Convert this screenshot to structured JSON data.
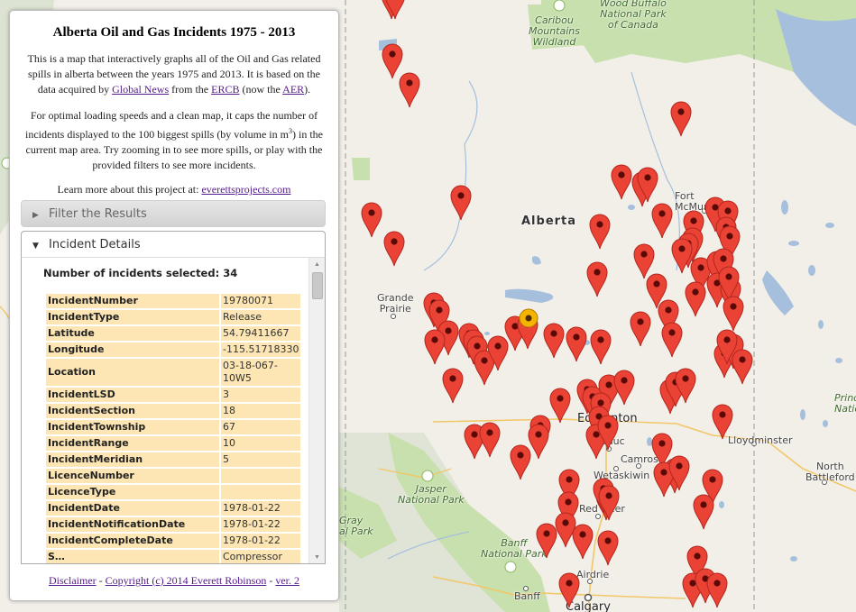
{
  "panel": {
    "title": "Alberta Oil and Gas Incidents 1975 - 2013",
    "intro": {
      "text1": "This is a map that interactively graphs all of the Oil and Gas related spills in alberta between the years 1975 and 2013. It is based on the data acquired by ",
      "link_global_news": "Global News",
      "text2": " from the ",
      "link_ercb": "ERCB",
      "text3": " (now the ",
      "link_aer": "AER",
      "text4": ")."
    },
    "cap_note": {
      "text1": "For optimal loading speeds and a clean map, it caps the number of incidents displayed to the 100 biggest spills (by volume in m",
      "sup": "3",
      "text2": ") in the current map area. Try zooming in to see more spills, or play with the provided filters to see more incidents."
    },
    "learn_more": {
      "text": "Learn more about this project at: ",
      "link": "everettsprojects.com"
    },
    "filter_section": {
      "label": "Filter the Results",
      "expanded": false
    },
    "details_section": {
      "label": "Incident Details",
      "expanded": true,
      "count_label": "Number of incidents selected: 34",
      "rows": [
        {
          "key": "IncidentNumber",
          "value": "19780071"
        },
        {
          "key": "IncidentType",
          "value": "Release"
        },
        {
          "key": "Latitude",
          "value": "54.79411667"
        },
        {
          "key": "Longitude",
          "value": "-115.51718330"
        },
        {
          "key": "Location",
          "value": "03-18-067-10W5"
        },
        {
          "key": "IncidentLSD",
          "value": "3"
        },
        {
          "key": "IncidentSection",
          "value": "18"
        },
        {
          "key": "IncidentTownship",
          "value": "67"
        },
        {
          "key": "IncidentRange",
          "value": "10"
        },
        {
          "key": "IncidentMeridian",
          "value": "5"
        },
        {
          "key": "LicenceNumber",
          "value": ""
        },
        {
          "key": "LicenceType",
          "value": ""
        },
        {
          "key": "IncidentDate",
          "value": "1978-01-22"
        },
        {
          "key": "IncidentNotificationDate",
          "value": "1978-01-22"
        },
        {
          "key": "IncidentCompleteDate",
          "value": "1978-01-22"
        },
        {
          "key": "S…",
          "value": "Compressor"
        }
      ]
    },
    "footer": {
      "disclaimer": "Disclaimer",
      "sep1": " - ",
      "copyright": "Copyright (c) 2014 Everett Robinson",
      "sep2": " - ",
      "version": "ver. 2"
    }
  },
  "map": {
    "labels": {
      "caribou": "Caribou\nMountains\nWildland",
      "wood_buffalo": "Wood Buffalo\nNational Park\nof Canada",
      "fort_mcmurray": "Fort\nMcMurray",
      "alberta": "Alberta",
      "grande_prairie": "Grande\nPrairie",
      "edmonton": "Edmonton",
      "leduc": "Leduc",
      "camrose": "Camrose",
      "wetaskiwin": "Wetaskiwin",
      "lloydminster": "Lloydminster",
      "north_battleford": "North\nBattleford",
      "prince_albert": "Prince\nNational",
      "jasper": "Jasper\nNational Park",
      "gray_park": "Gray\nal Park",
      "red_deer": "Red Deer",
      "banff_park": "Banff\nNational Park",
      "banff": "Banff",
      "airdrie": "Airdrie",
      "calgary": "Calgary"
    },
    "colors": {
      "pin": "#ea4335",
      "pin_selected": "#f5b400",
      "water": "#a5bfdd",
      "park": "#c8dfae",
      "road": "#f2c768"
    },
    "selected_incident": "19780071"
  }
}
